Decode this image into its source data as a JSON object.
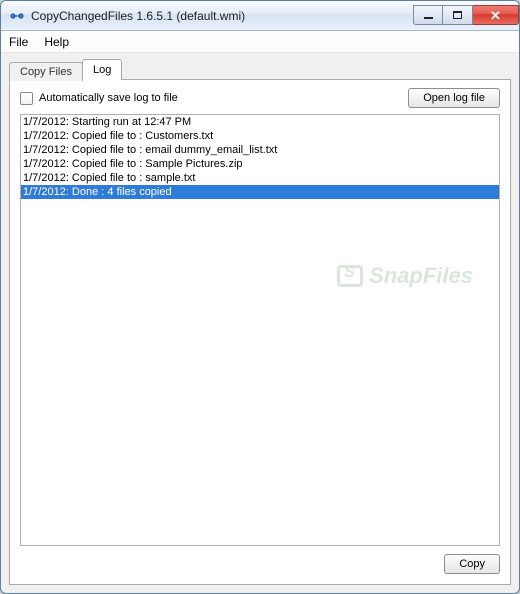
{
  "window": {
    "title": "CopyChangedFiles 1.6.5.1 (default.wmi)"
  },
  "menubar": {
    "file": "File",
    "help": "Help"
  },
  "tabs": {
    "copy_files": "Copy Files",
    "log": "Log"
  },
  "log_panel": {
    "auto_save_label": "Automatically save log to file",
    "open_log_btn": "Open log file",
    "copy_btn": "Copy",
    "entries": [
      {
        "text": "1/7/2012: Starting run at 12:47 PM",
        "selected": false
      },
      {
        "text": "1/7/2012: Copied file to : Customers.txt",
        "selected": false
      },
      {
        "text": "1/7/2012: Copied file to : email dummy_email_list.txt",
        "selected": false
      },
      {
        "text": "1/7/2012: Copied file to : Sample Pictures.zip",
        "selected": false
      },
      {
        "text": "1/7/2012: Copied file to : sample.txt",
        "selected": false
      },
      {
        "text": "1/7/2012: Done : 4 files copied",
        "selected": true
      }
    ]
  },
  "watermark": "SnapFiles"
}
